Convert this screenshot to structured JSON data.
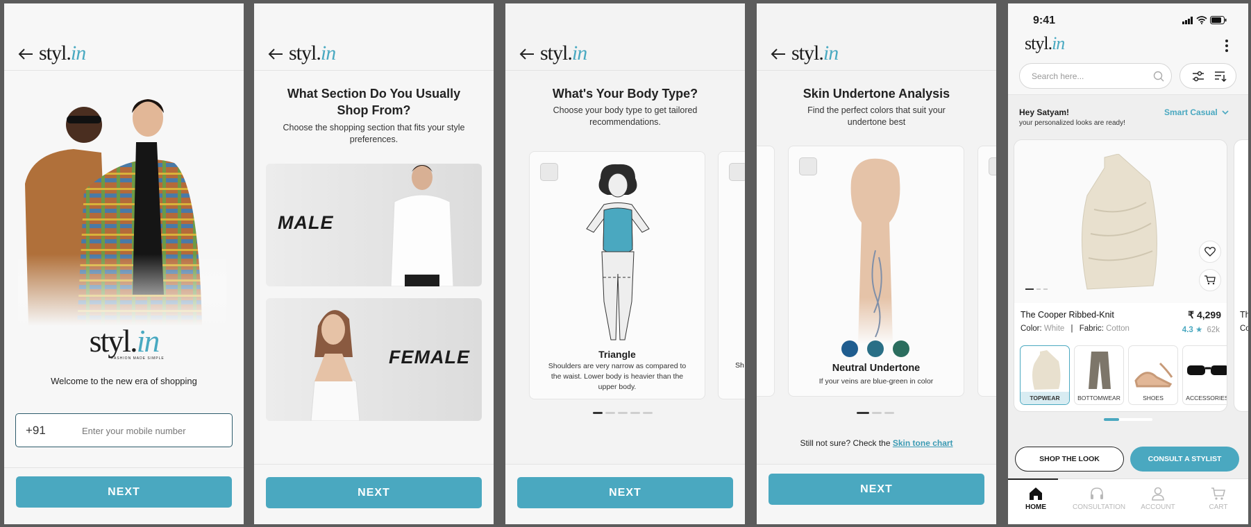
{
  "brand": {
    "name_main": "styl.",
    "name_accent": "in",
    "tagline": "FASHION MADE SIMPLE",
    "accent": "#4aa8c0"
  },
  "screen1": {
    "welcome": "Welcome to the new era of shopping",
    "country_code": "+91",
    "phone_placeholder": "Enter your mobile number",
    "next": "NEXT"
  },
  "screen2": {
    "title": "What Section Do You Usually Shop From?",
    "subtitle": "Choose the shopping section that fits your style preferences.",
    "options": [
      "MALE",
      "FEMALE"
    ],
    "next": "NEXT"
  },
  "screen3": {
    "title": "What's Your Body Type?",
    "subtitle": "Choose your body type to get tailored recommendations.",
    "card_title": "Triangle",
    "card_desc": "Shoulders are very narrow as compared to the waist. Lower body is heavier than the upper body.",
    "peek_text": "Sh",
    "next": "NEXT"
  },
  "screen4": {
    "title": "Skin Undertone Analysis",
    "subtitle": "Find the perfect colors that suit your undertone best",
    "card_title": "Neutral Undertone",
    "card_desc": "If your veins are blue-green in color",
    "swatches": [
      "#1f5d8f",
      "#2a6f86",
      "#2b6d5e"
    ],
    "help_text": "Still not sure? Check the",
    "help_link": "Skin tone chart",
    "next": "NEXT"
  },
  "screen5": {
    "status_time": "9:41",
    "search_placeholder": "Search here...",
    "greeting": "Hey Satyam!",
    "greeting_sub": "your personalized looks are ready!",
    "occasion": "Smart Casual",
    "product": {
      "name": "The Cooper Ribbed-Knit",
      "price": "₹ 4,299",
      "color_label": "Color:",
      "color_value": "White",
      "fabric_label": "Fabric:",
      "fabric_value": "Cotton",
      "rating": "4.3",
      "reviews": "62k"
    },
    "peek_letters": [
      "Th",
      "Co"
    ],
    "categories": [
      "TOPWEAR",
      "BOTTOMWEAR",
      "SHOES",
      "ACCESSORIES"
    ],
    "shop_look": "SHOP THE LOOK",
    "consult": "CONSULT A STYLIST",
    "nav": [
      "HOME",
      "CONSULTATION",
      "ACCOUNT",
      "CART"
    ]
  }
}
